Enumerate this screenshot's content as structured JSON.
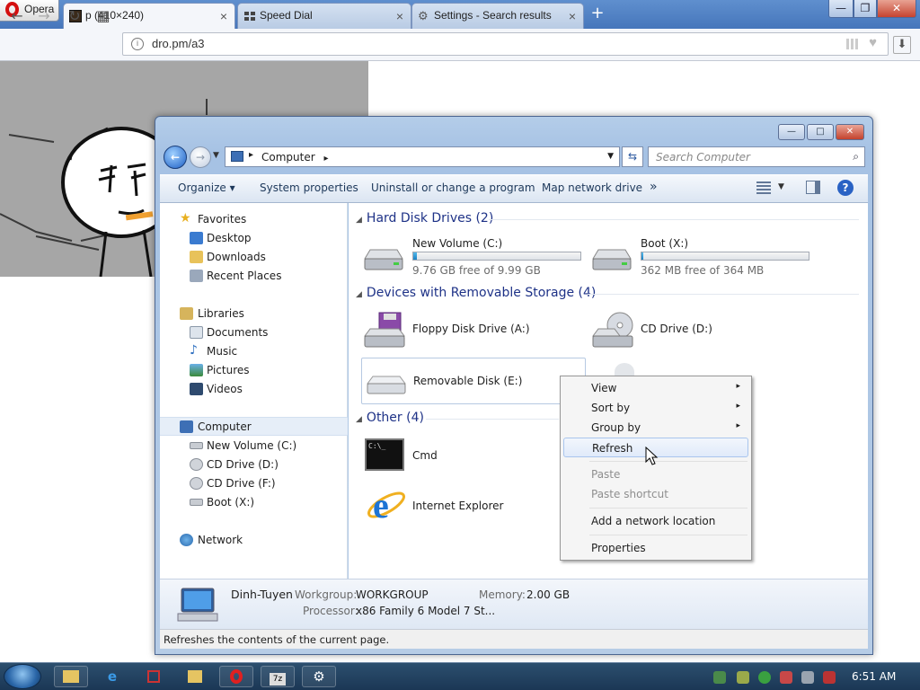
{
  "browser": {
    "menu_label": "Opera",
    "tabs": [
      {
        "label": "p (410×240)",
        "close": "×"
      },
      {
        "label": "Speed Dial",
        "close": "×"
      },
      {
        "label": "Settings - Search results",
        "close": "×"
      }
    ],
    "new_tab": "+",
    "window_controls": {
      "minimize": "—",
      "maximize": "❐",
      "close": "✕"
    },
    "nav": {
      "back": "←",
      "forward": "→",
      "reload": "↻",
      "speed_dial": "▦",
      "download": "⬇"
    },
    "address": "dro.pm/a3",
    "bookmark_icon": "♥"
  },
  "explorer": {
    "caption_buttons": {
      "minimize": "—",
      "maximize": "□",
      "close": "✕"
    },
    "path": {
      "root": "Computer",
      "sep": "▸"
    },
    "search_placeholder": "Search Computer",
    "toolbar": {
      "organize": "Organize ▾",
      "system_properties": "System properties",
      "uninstall": "Uninstall or change a program",
      "map_network_drive": "Map network drive",
      "more": "»"
    },
    "nav": {
      "favorites": "Favorites",
      "desktop": "Desktop",
      "downloads": "Downloads",
      "recent_places": "Recent Places",
      "libraries": "Libraries",
      "documents": "Documents",
      "music": "Music",
      "pictures": "Pictures",
      "videos": "Videos",
      "computer": "Computer",
      "new_volume": "New Volume (C:)",
      "cd_drive_d": "CD Drive (D:)",
      "cd_drive_f": "CD Drive (F:)",
      "boot": "Boot (X:)",
      "network": "Network"
    },
    "groups": {
      "hdd": "Hard Disk Drives (2)",
      "removable": "Devices with Removable Storage (4)",
      "other": "Other (4)"
    },
    "drives": [
      {
        "name": "New Volume (C:)",
        "free": "9.76 GB free of 9.99 GB",
        "used_fraction": 0.023
      },
      {
        "name": "Boot (X:)",
        "free": "362 MB free of 364 MB",
        "used_fraction": 0.005
      }
    ],
    "removable": {
      "floppy": "Floppy Disk Drive (A:)",
      "cd": "CD Drive (D:)",
      "removable_disk": "Removable Disk (E:)"
    },
    "other": {
      "cmd": "Cmd",
      "ie": "Internet Explorer"
    },
    "details": {
      "computer_name": "Dinh-Tuyen",
      "workgroup_label": "Workgroup:",
      "workgroup": "WORKGROUP",
      "memory_label": "Memory:",
      "memory": "2.00 GB",
      "processor_label": "Processor:",
      "processor": "x86 Family 6 Model 7 St..."
    },
    "status": "Refreshes the contents of the current page."
  },
  "context_menu": {
    "view": "View",
    "sort_by": "Sort by",
    "group_by": "Group by",
    "refresh": "Refresh",
    "paste": "Paste",
    "paste_shortcut": "Paste shortcut",
    "add_network_location": "Add a network location",
    "properties": "Properties",
    "submenu_arrow": "▸"
  },
  "taskbar": {
    "clock": "6:51 AM"
  }
}
